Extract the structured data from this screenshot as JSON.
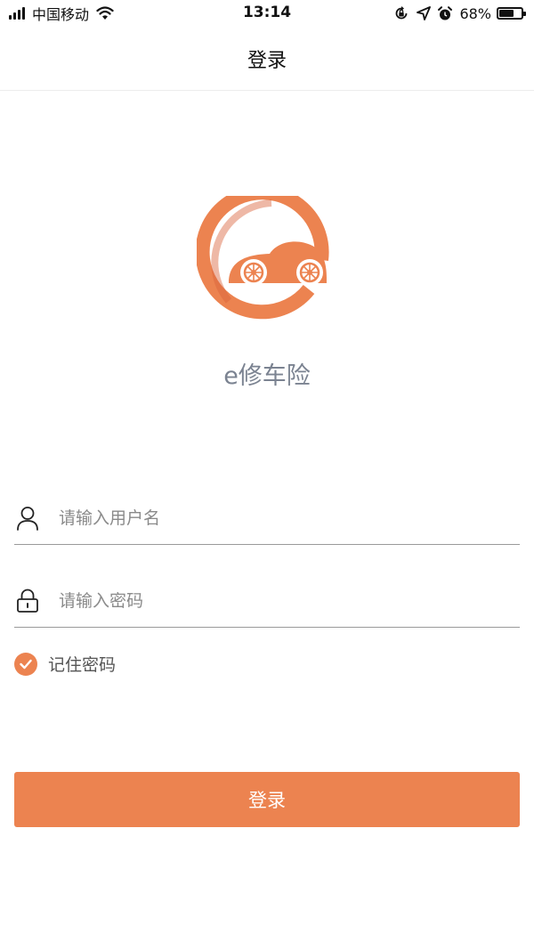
{
  "status_bar": {
    "carrier": "中国移动",
    "time": "13:14",
    "battery_percent": "68%",
    "battery_level": 0.68,
    "icons": [
      "signal-icon",
      "wifi-icon",
      "orientation-lock-icon",
      "location-icon",
      "alarm-icon",
      "battery-icon"
    ]
  },
  "nav": {
    "title": "登录"
  },
  "logo": {
    "app_name": "e修车险",
    "color": "#ec8350"
  },
  "form": {
    "username": {
      "placeholder": "请输入用户名",
      "value": "",
      "icon": "user-icon"
    },
    "password": {
      "placeholder": "请输入密码",
      "value": "",
      "icon": "lock-icon"
    },
    "remember": {
      "label": "记住密码",
      "checked": true
    }
  },
  "login_button": {
    "label": "登录"
  },
  "colors": {
    "accent": "#ec8350",
    "app_name": "#7b8391"
  }
}
